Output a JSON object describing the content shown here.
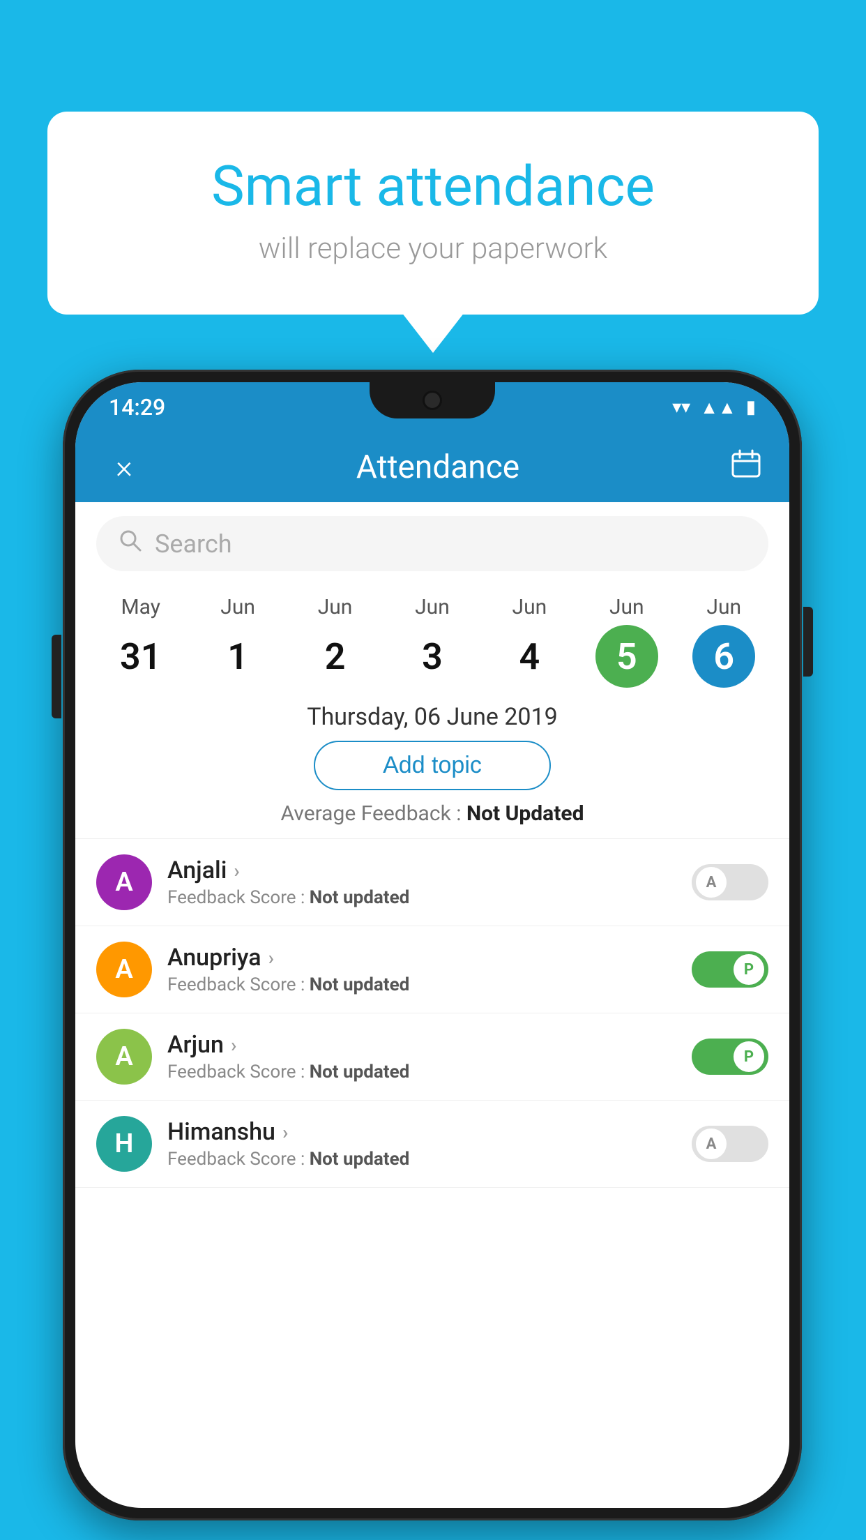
{
  "background_color": "#1ab8e8",
  "speech_bubble": {
    "title": "Smart attendance",
    "subtitle": "will replace your paperwork"
  },
  "phone": {
    "status_bar": {
      "time": "14:29",
      "icons": [
        "wifi",
        "signal",
        "battery"
      ]
    },
    "header": {
      "close_label": "×",
      "title": "Attendance",
      "calendar_icon": "📅"
    },
    "search": {
      "placeholder": "Search"
    },
    "date_selector": {
      "dates": [
        {
          "month": "May",
          "day": "31",
          "state": "normal"
        },
        {
          "month": "Jun",
          "day": "1",
          "state": "normal"
        },
        {
          "month": "Jun",
          "day": "2",
          "state": "normal"
        },
        {
          "month": "Jun",
          "day": "3",
          "state": "normal"
        },
        {
          "month": "Jun",
          "day": "4",
          "state": "normal"
        },
        {
          "month": "Jun",
          "day": "5",
          "state": "today"
        },
        {
          "month": "Jun",
          "day": "6",
          "state": "selected"
        }
      ]
    },
    "selected_date_label": "Thursday, 06 June 2019",
    "add_topic_label": "Add topic",
    "avg_feedback_prefix": "Average Feedback : ",
    "avg_feedback_value": "Not Updated",
    "students": [
      {
        "name": "Anjali",
        "avatar_letter": "A",
        "avatar_color": "avatar-purple",
        "feedback_label": "Feedback Score : ",
        "feedback_value": "Not updated",
        "attendance": "absent",
        "toggle_letter": "A"
      },
      {
        "name": "Anupriya",
        "avatar_letter": "A",
        "avatar_color": "avatar-orange",
        "feedback_label": "Feedback Score : ",
        "feedback_value": "Not updated",
        "attendance": "present",
        "toggle_letter": "P"
      },
      {
        "name": "Arjun",
        "avatar_letter": "A",
        "avatar_color": "avatar-green",
        "feedback_label": "Feedback Score : ",
        "feedback_value": "Not updated",
        "attendance": "present",
        "toggle_letter": "P"
      },
      {
        "name": "Himanshu",
        "avatar_letter": "H",
        "avatar_color": "avatar-teal",
        "feedback_label": "Feedback Score : ",
        "feedback_value": "Not updated",
        "attendance": "absent",
        "toggle_letter": "A"
      }
    ]
  }
}
